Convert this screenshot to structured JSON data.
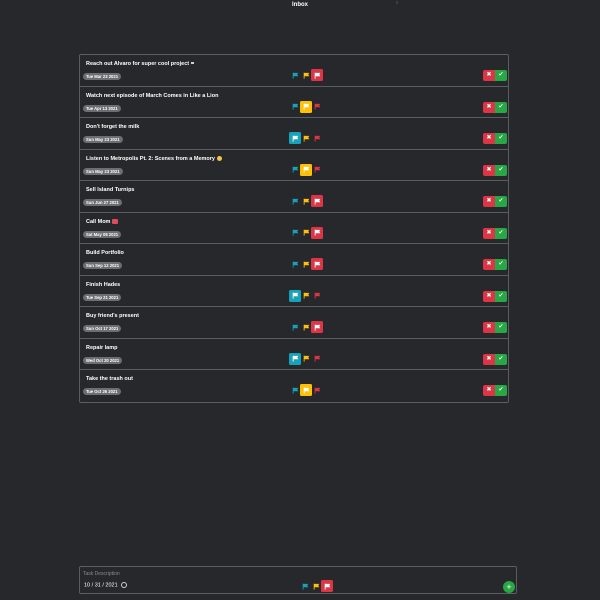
{
  "header": {
    "title": "Inbox"
  },
  "colors": {
    "background": "#26282b",
    "border": "#5a5d61",
    "date_badge": "#6b6f74",
    "priority_low": "#17a2b8",
    "priority_medium": "#ffc107",
    "priority_high": "#dc3545",
    "delete": "#dc3545",
    "complete": "#28a745"
  },
  "tasks": [
    {
      "title": "Reach out Alvaro for super cool project",
      "emoji": "spark",
      "date": "Tue Mar 23 2021",
      "priority": "high"
    },
    {
      "title": "Watch next episode of March Comes in Like a Lion",
      "emoji": "",
      "date": "Tue Apr 13 2021",
      "priority": "medium"
    },
    {
      "title": "Don't forget the milk",
      "emoji": "",
      "date": "Sun May 23 2021",
      "priority": "low"
    },
    {
      "title": "Listen to Metropolis Pt. 2: Scenes from a Memory",
      "emoji": "wink",
      "date": "Sun May 23 2021",
      "priority": "medium"
    },
    {
      "title": "Sell Island Turnips",
      "emoji": "",
      "date": "Sun Jun 27 2021",
      "priority": "high"
    },
    {
      "title": "Call Mom",
      "emoji": "call",
      "date": "Sat May 08 2021",
      "priority": "high"
    },
    {
      "title": "Build Portfolio",
      "emoji": "",
      "date": "Sun Sep 12 2021",
      "priority": "high"
    },
    {
      "title": "Finish Hades",
      "emoji": "",
      "date": "Tue Sep 21 2021",
      "priority": "low"
    },
    {
      "title": "Buy friend's present",
      "emoji": "",
      "date": "Sun Oct 17 2021",
      "priority": "high"
    },
    {
      "title": "Repair lamp",
      "emoji": "",
      "date": "Wed Oct 20 2021",
      "priority": "low"
    },
    {
      "title": "Take the trash out",
      "emoji": "",
      "date": "Tue Oct 26 2021",
      "priority": "medium"
    }
  ],
  "icons": {
    "flag": "flag-icon",
    "delete": "close-icon",
    "complete": "check-icon",
    "add": "plus-icon",
    "calendar": "calendar-icon"
  },
  "new_task": {
    "placeholder": "Task Description",
    "date": "10 / 31 / 2021",
    "priority": "high",
    "add_label": "+"
  },
  "actions": {
    "delete_label": "✖",
    "complete_label": "✔"
  }
}
